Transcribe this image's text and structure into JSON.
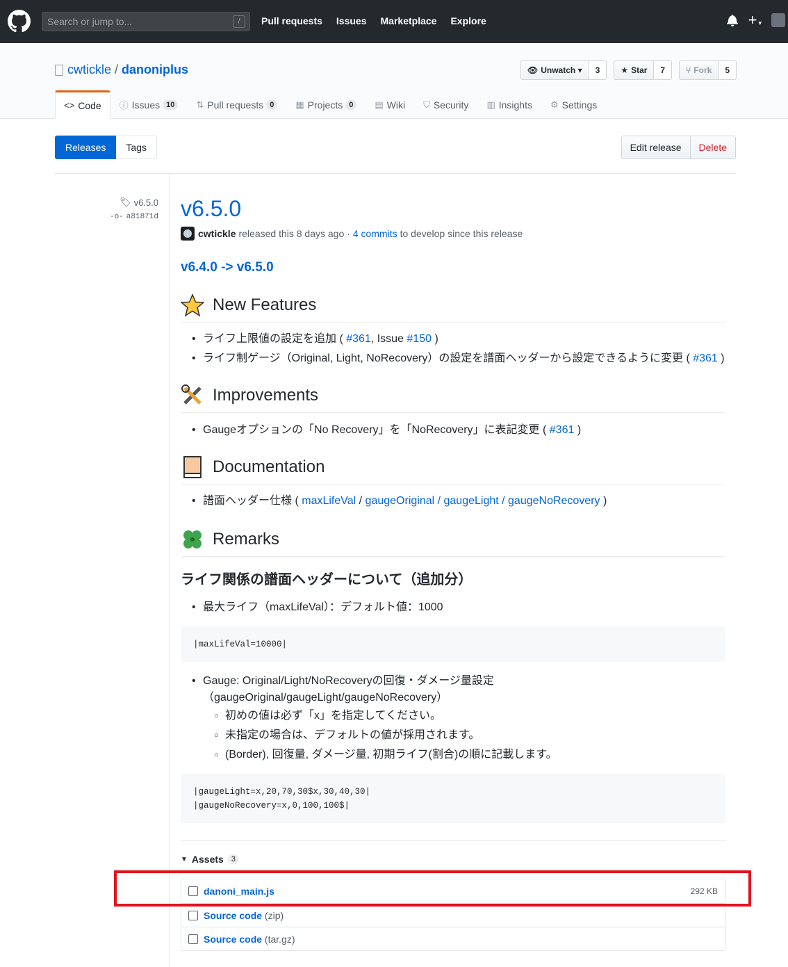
{
  "header": {
    "search_placeholder": "Search or jump to...",
    "slash_key": "/",
    "nav": [
      "Pull requests",
      "Issues",
      "Marketplace",
      "Explore"
    ]
  },
  "repo": {
    "owner": "cwtickle",
    "separator": "/",
    "name": "danoniplus",
    "unwatch_label": "Unwatch",
    "watch_count": "3",
    "star_label": "Star",
    "star_count": "7",
    "fork_label": "Fork",
    "fork_count": "5",
    "tabs": [
      {
        "label": "Code",
        "count": ""
      },
      {
        "label": "Issues",
        "count": "10"
      },
      {
        "label": "Pull requests",
        "count": "0"
      },
      {
        "label": "Projects",
        "count": "0"
      },
      {
        "label": "Wiki",
        "count": ""
      },
      {
        "label": "Security",
        "count": ""
      },
      {
        "label": "Insights",
        "count": ""
      },
      {
        "label": "Settings",
        "count": ""
      }
    ]
  },
  "subnav": {
    "releases": "Releases",
    "tags": "Tags",
    "edit": "Edit release",
    "delete": "Delete"
  },
  "release": {
    "tag": "v6.5.0",
    "commit": "a81871d",
    "title": "v6.5.0",
    "author": "cwtickle",
    "released_text": "released this 8 days ago ·",
    "commits_link": "4 commits",
    "since_text": "to develop since this release",
    "compare_link": "v6.4.0 -> v6.5.0",
    "sections": {
      "new_features": "New Features",
      "improvements": "Improvements",
      "documentation": "Documentation",
      "remarks": "Remarks"
    },
    "nf_item1_text": "ライフ上限値の設定を追加 ( ",
    "nf_item1_link1": "#361",
    "nf_item1_mid": ", Issue ",
    "nf_item1_link2": "#150",
    "nf_item1_end": " )",
    "nf_item2_text": "ライフ制ゲージ（Original, Light, NoRecovery）の設定を譜面ヘッダーから設定できるように変更 ( ",
    "nf_item2_link": "#361",
    "nf_item2_end": " )",
    "imp_item_text": "Gaugeオプションの「No Recovery」を「NoRecovery」に表記変更 ( ",
    "imp_item_link": "#361",
    "imp_item_end": " )",
    "doc_item_text": "譜面ヘッダー仕様 ( ",
    "doc_link1": "maxLifeVal",
    "doc_sep1": " / ",
    "doc_link2": "gaugeOriginal / gaugeLight / gaugeNoRecovery",
    "doc_end": " )",
    "remarks_h2": "ライフ関係の譜面ヘッダーについて（追加分）",
    "rem_item1": "最大ライフ（maxLifeVal）：デフォルト値：1000",
    "code1": "|maxLifeVal=10000|",
    "rem_item2_line1": "Gauge: Original/Light/NoRecoveryの回復・ダメージ量設定",
    "rem_item2_line2": "（gaugeOriginal/gaugeLight/gaugeNoRecovery）",
    "rem_sub": [
      "初めの値は必ず「x」を指定してください。",
      "未指定の場合は、デフォルトの値が採用されます。",
      "(Border), 回復量, ダメージ量, 初期ライフ(割合)の順に記載します。"
    ],
    "code2_line1": "|gaugeLight=x,20,70,30$x,30,40,30|",
    "code2_line2": "|gaugeNoRecovery=x,0,100,100$|"
  },
  "assets": {
    "label": "Assets",
    "count": "3",
    "items": [
      {
        "name": "danoni_main.js",
        "suffix": "",
        "size": "292 KB"
      },
      {
        "name": "Source code",
        "suffix": "(zip)",
        "size": ""
      },
      {
        "name": "Source code",
        "suffix": "(tar.gz)",
        "size": ""
      }
    ]
  },
  "colors": {
    "header_bg": "#24292e",
    "link": "#0366d6",
    "delete": "#cb2431",
    "highlight": "#e0141e",
    "tab_accent": "#e36209"
  }
}
